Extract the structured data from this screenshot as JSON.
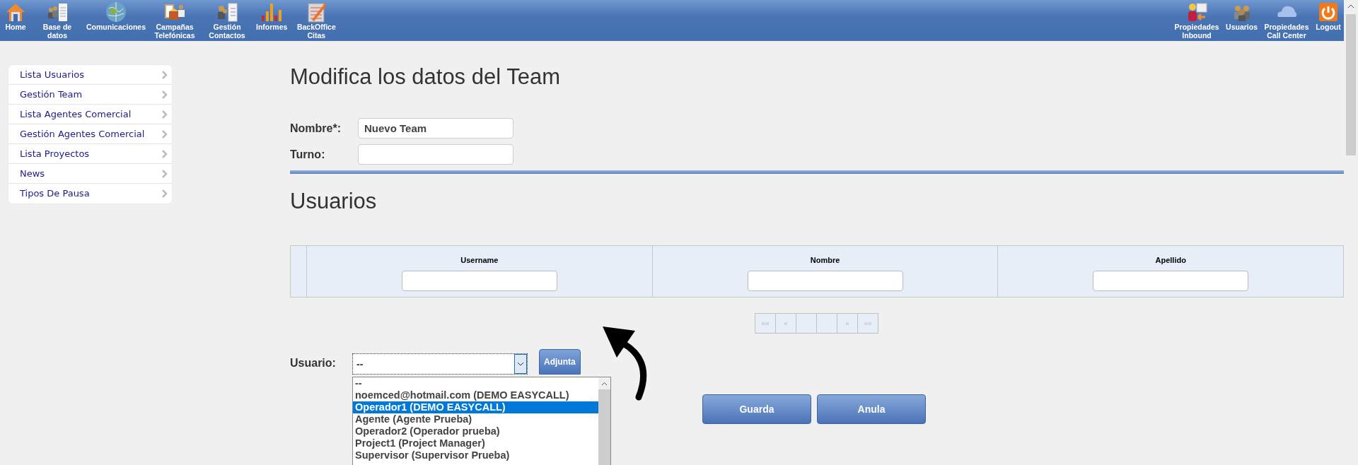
{
  "top_nav": {
    "left": [
      {
        "label": "Home"
      },
      {
        "label": "Base de datos"
      },
      {
        "label": "Comunicaciones"
      },
      {
        "label": "Campañas Telefónicas"
      },
      {
        "label": "Gestión Contactos"
      },
      {
        "label": "Informes"
      },
      {
        "label": "BackOffice Citas"
      }
    ],
    "right": [
      {
        "label": "Propiedades Inbound"
      },
      {
        "label": "Usuarios"
      },
      {
        "label": "Propiedades Call Center"
      },
      {
        "label": "Logout"
      }
    ]
  },
  "sidebar": {
    "items": [
      {
        "label": "Lista Usuarios"
      },
      {
        "label": "Gestión Team"
      },
      {
        "label": "Lista Agentes Comercial"
      },
      {
        "label": "Gestión Agentes Comercial"
      },
      {
        "label": "Lista Proyectos"
      },
      {
        "label": "News"
      },
      {
        "label": "Tipos De Pausa"
      }
    ]
  },
  "form": {
    "title": "Modifica los datos del Team",
    "fields": [
      {
        "label": "Nombre*:",
        "value": "Nuevo Team"
      },
      {
        "label": "Turno:"
      }
    ]
  },
  "users": {
    "title": "Usuarios",
    "table": {
      "columns": [
        "Username",
        "Nombre",
        "Apellido"
      ]
    },
    "pager": {
      "first": "««",
      "prev": "«",
      "next": "»",
      "last": "»»"
    },
    "usuario_label": "Usuario:",
    "select_value": "--",
    "attach_button": "Adjunta",
    "dropdown": [
      {
        "label": "--",
        "selected": false
      },
      {
        "label": "noemced@hotmail.com (DEMO EASYCALL)",
        "selected": false
      },
      {
        "label": "Operador1 (DEMO EASYCALL)",
        "selected": true
      },
      {
        "label": "Agente (Agente Prueba)",
        "selected": false
      },
      {
        "label": "Operador2 (Operador prueba)",
        "selected": false
      },
      {
        "label": "Project1 (Project Manager)",
        "selected": false
      },
      {
        "label": "Supervisor (Supervisor Prueba)",
        "selected": false
      }
    ]
  },
  "buttons": [
    "Guarda",
    "Anula"
  ]
}
